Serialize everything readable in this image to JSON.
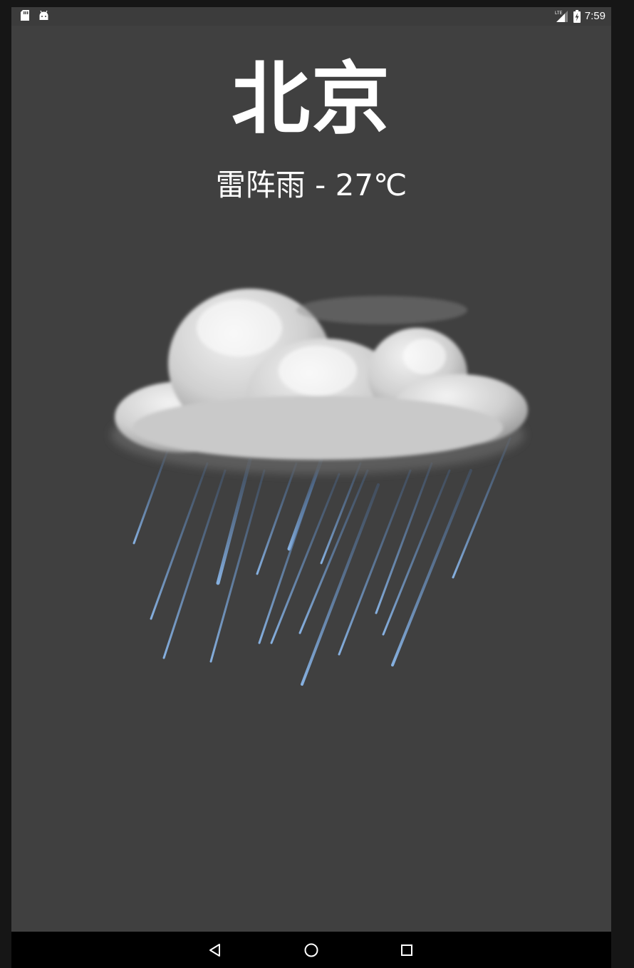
{
  "status_bar": {
    "left_icons": [
      "sd-card-icon",
      "android-icon"
    ],
    "network": "LTE",
    "time": "7:59"
  },
  "city": "北京",
  "weather": {
    "condition": "雷阵雨",
    "separator": " - ",
    "temperature": "27℃",
    "icon": "thunderstorm-rain-cloud-icon"
  },
  "nav_bar": {
    "buttons": [
      "back-icon",
      "home-icon",
      "recents-icon"
    ]
  },
  "colors": {
    "background": "#404040",
    "text": "#ffffff",
    "rain": "#6f9fd8"
  }
}
